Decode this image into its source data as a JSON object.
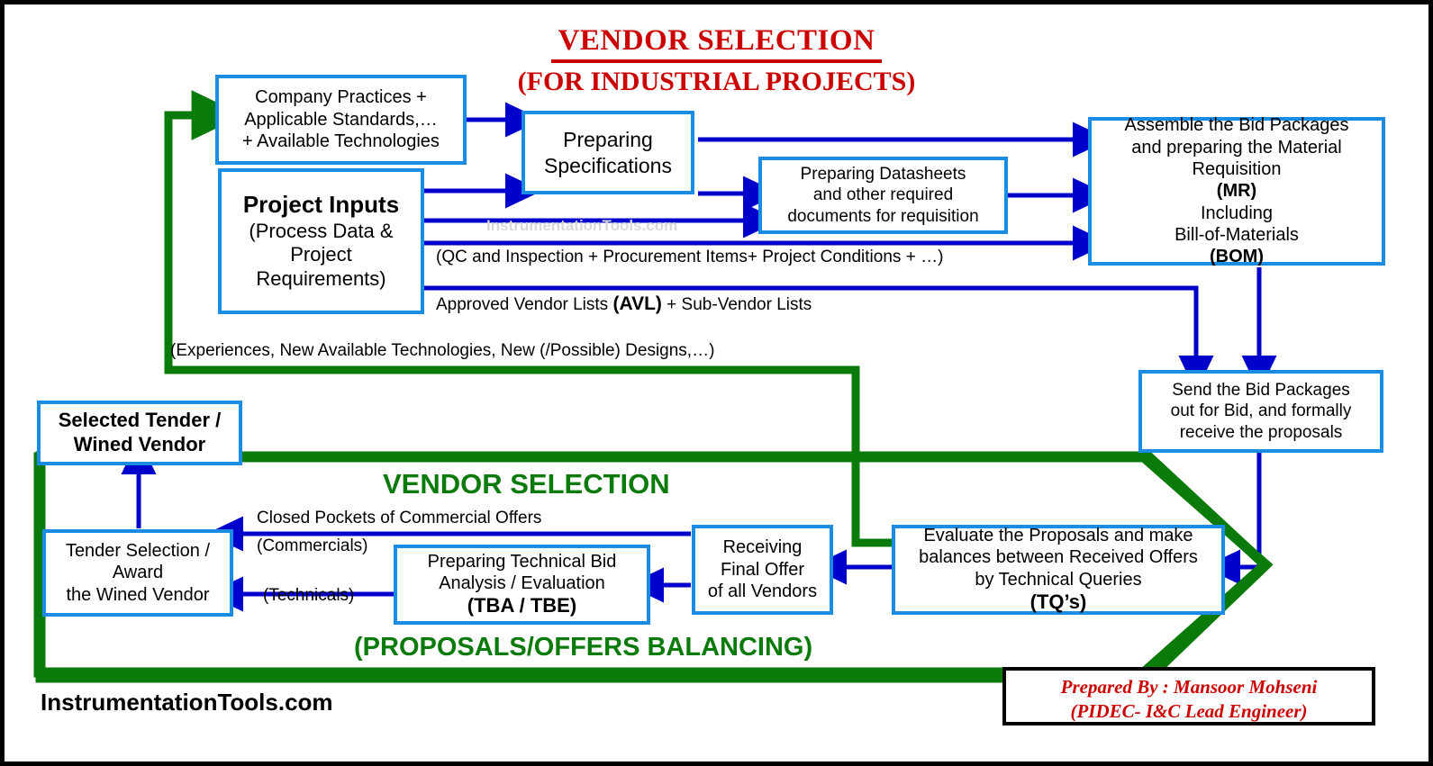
{
  "title": {
    "line1": "VENDOR SELECTION",
    "line2": "(FOR INDUSTRIAL PROJECTS)",
    "color": "#cc0000"
  },
  "watermark": "InstrumentationTools.com",
  "brand": "InstrumentationTools.com",
  "credit": {
    "line1": "Prepared By : Mansoor Mohseni",
    "line2": "(PIDEC- I&C Lead Engineer)",
    "color": "#cc0000"
  },
  "colors": {
    "box_border": "#1b8ce3",
    "blue_arrow": "#0000cc",
    "green_loop": "#0a7a0a",
    "text": "#000000",
    "watermark": "#d8d8d8"
  },
  "boxes": {
    "company_practices": {
      "lines": [
        "Company Practices +",
        "Applicable Standards,…",
        "+ Available Technologies"
      ]
    },
    "project_inputs": {
      "line_bold": "Project Inputs",
      "lines": [
        "(Process Data &",
        "Project",
        "Requirements)"
      ]
    },
    "preparing_specs": {
      "lines": [
        "Preparing",
        "Specifications"
      ]
    },
    "preparing_datasheets": {
      "lines": [
        "Preparing Datasheets",
        "and other required",
        "documents for requisition"
      ]
    },
    "assemble_bid": {
      "line1": "Assemble the Bid Packages",
      "line2": "and preparing the Material",
      "line3_a": "Requisition ",
      "line3_b": "(MR)",
      "line3_c": " Including",
      "line4_a": "Bill-of-Materials ",
      "line4_b": "(BOM)"
    },
    "send_bid": {
      "lines": [
        "Send the Bid Packages",
        "out for Bid, and formally",
        "receive the proposals"
      ]
    },
    "evaluate_proposals": {
      "line1": "Evaluate the Proposals and make",
      "line2": "balances between Received Offers",
      "line3_a": "by Technical Queries ",
      "line3_b": "(TQ’s)"
    },
    "receiving_final_offer": {
      "lines": [
        "Receiving",
        "Final Offer",
        "of all Vendors"
      ]
    },
    "tba_tbe": {
      "line1": "Preparing Technical Bid",
      "line2": "Analysis / Evaluation",
      "line3_bold": "(TBA / TBE)"
    },
    "tender_selection": {
      "lines": [
        "Tender Selection /",
        "Award",
        "the Wined Vendor"
      ]
    },
    "selected_tender": {
      "lines": [
        "Selected Tender /",
        "Wined Vendor"
      ]
    }
  },
  "edge_labels": {
    "qc_inspection": "(QC and Inspection + Procurement Items+ Project Conditions + …)",
    "avl_a": "Approved Vendor Lists ",
    "avl_b": "(AVL)",
    "avl_c": " + Sub-Vendor Lists",
    "experiences": "(Experiences, New Available Technologies, New (/Possible) Designs,…)",
    "closed_pockets": "Closed Pockets of Commercial Offers",
    "commercials": "(Commercials)",
    "technicals": "(Technicals)"
  },
  "annotations": {
    "vendor_selection_green": "VENDOR SELECTION",
    "proposals_balancing_green": "(PROPOSALS/OFFERS BALANCING)"
  }
}
